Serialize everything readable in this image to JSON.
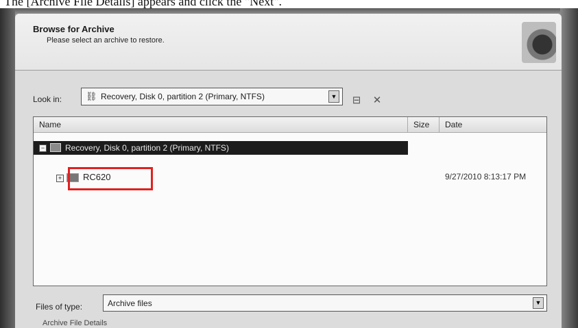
{
  "caption": {
    "text": "The [Archive File Details] appears and click the \"Next\"."
  },
  "dialog": {
    "title": "Browse for Archive",
    "subtitle": "Please select an archive to restore."
  },
  "lookin": {
    "label": "Look in:",
    "value": "Recovery, Disk 0, partition 2 (Primary, NTFS)",
    "dropdown_glyph": "▼"
  },
  "list": {
    "columns": [
      "Name",
      "Size",
      "Date"
    ],
    "root": {
      "label": "Recovery, Disk 0, partition 2 (Primary, NTFS)",
      "expander": "−"
    },
    "child": {
      "label": "RC620",
      "expander": "+",
      "date": "9/27/2010 8:13:17 PM"
    }
  },
  "files_of_type": {
    "label": "Files of type:",
    "value": "Archive files",
    "dropdown_glyph": "▼"
  },
  "details": {
    "label": "Archive File Details"
  },
  "colors": {
    "highlight": "#e02020",
    "selection": "#1c1c1c"
  },
  "icons": [
    "disk-icon",
    "network-icon",
    "tools-icon",
    "folder-icon",
    "mouse-cursor-icon"
  ]
}
